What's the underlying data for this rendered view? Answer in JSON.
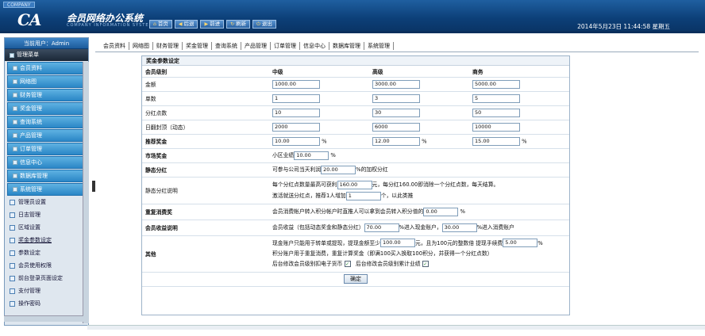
{
  "header": {
    "brand_tag": "COMPANY",
    "logo": "CA",
    "title": "会员网络办公系统",
    "subtitle": "COMPANY INFORMATION SYSTEM",
    "toolbar": [
      "首页",
      "后退",
      "前进",
      "刷新",
      "退出"
    ],
    "datetime": "2014年5月23日  11:44:58 星期五"
  },
  "sidebar": {
    "user": "当前用户：Admin",
    "menu_title": "管理菜单",
    "items": [
      "会员资料",
      "网络图",
      "财务管理",
      "奖金管理",
      "查询系统",
      "产品管理",
      "订单管理",
      "信息中心",
      "数据库管理",
      "系统管理"
    ],
    "subitems": [
      "管理员设置",
      "日志管理",
      "区域设置",
      "奖金参数设定",
      "参数设定",
      "会员使用权限",
      "前台登录页面设定",
      "支付管理",
      "操作密码"
    ]
  },
  "nav": [
    "会员资料",
    "网络图",
    "财务管理",
    "奖金管理",
    "查询系统",
    "产品管理",
    "订单管理",
    "信息中心",
    "数据库管理",
    "系统管理"
  ],
  "page": {
    "title": "奖金参数设定",
    "columns": [
      "会员级别",
      "中级",
      "高级",
      "商务"
    ],
    "rows": [
      {
        "label": "金额",
        "values": [
          "1000.00",
          "3000.00",
          "5000.00"
        ]
      },
      {
        "label": "单数",
        "values": [
          "1",
          "3",
          "5"
        ]
      },
      {
        "label": "分红点数",
        "values": [
          "10",
          "30",
          "50"
        ]
      },
      {
        "label": "日翻封顶（动态）",
        "values": [
          "2000",
          "6000",
          "10000"
        ]
      }
    ],
    "recommend": {
      "label": "推荐奖金",
      "values": [
        "10.00",
        "12.00",
        "15.00"
      ],
      "unit": "%"
    },
    "market": {
      "label": "市场奖金",
      "text": "小区业绩",
      "value": "10.00",
      "unit": "%"
    },
    "static": {
      "label": "静态分红",
      "pre": "可参与公司当天利润",
      "value": "20.00",
      "post": "%的加权分红"
    },
    "static_note": {
      "label": "静态分红说明",
      "line1_pre": "每个分红点数量最高可获利",
      "line1_value": "160.00",
      "line1_post": "元，每分红160.00即消除一个分红点数，每天结算。",
      "line2_pre": "激活就送分红点，推荐1人增加",
      "line2_value": "1",
      "line2_post": "个，以此类推"
    },
    "repeat": {
      "label": "重复消费奖",
      "pre": "会员消费帐户转入积分帐户时直推人可以拿到会员转入积分值的",
      "value": "0.00",
      "unit": "%"
    },
    "income": {
      "label": "会员收益说明",
      "pre": "会员收益（包括动态奖金和静态分红）",
      "v1": "70.00",
      "mid": "%进入现金账户，",
      "v2": "30.00",
      "post": "%进入消费账户"
    },
    "other": {
      "label": "其他",
      "line1_pre": "现金账户只能用于转单或提现，提现金额至少",
      "line1_value": "100.00",
      "line1_mid": "元，且为100元的整数倍   提现手续费",
      "line1_value2": "5.00",
      "line1_unit": "%",
      "line2": "积分账户用于重复消费，重复计算奖金（即满100买入换取100积分，并获得一个分红点数）",
      "chk1": "后台修改会员级别扣电子货币",
      "chk2": "后台修改会员级别累计业绩"
    },
    "ok": "确定"
  }
}
